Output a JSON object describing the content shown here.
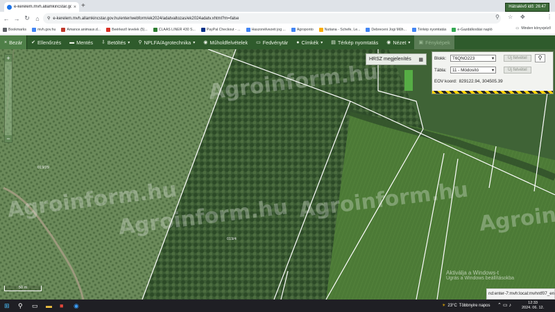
{
  "browser": {
    "tab_title": "e-kerelem.mvh.allamkincstar.go",
    "tab_close": "×",
    "new_tab": "+",
    "url": "e-kerelem.mvh.allamkincstar.gov.hu/enter/webform/ek2024/adatvaltozas/ek2024adatv.xhtml?m=false",
    "profile_initial": "K",
    "bookmarks": [
      {
        "label": "Bookmarks",
        "color": "#5f6368"
      },
      {
        "label": "mvh.gov.hu",
        "color": "#4285f4"
      },
      {
        "label": "Amance.animaux.d...",
        "color": "#c0392b"
      },
      {
        "label": "Beérkező levelek (5)...",
        "color": "#d93025"
      },
      {
        "label": "CLAAS LINER 430 S...",
        "color": "#2e7d32"
      },
      {
        "label": "PayPal Checkout - ...",
        "color": "#003087"
      },
      {
        "label": "Haszonélvezeti jog ...",
        "color": "#4285f4"
      },
      {
        "label": "Agroponto",
        "color": "#4285f4"
      },
      {
        "label": "Nutiana - Schefe, Le...",
        "color": "#f9ab00"
      },
      {
        "label": "Debreceni Jogi Műh...",
        "color": "#4285f4"
      },
      {
        "label": "Térkép nyomtatás",
        "color": "#4285f4"
      },
      {
        "label": "e-Gazdálkodási napló",
        "color": "#34a853"
      }
    ],
    "bookmarks_right": "Minden könyvjelző"
  },
  "toolbar": {
    "items": [
      {
        "label": "Bezár",
        "icon": "×",
        "disabled": false
      },
      {
        "label": "Ellenőrzés",
        "icon": "✔",
        "disabled": false
      },
      {
        "label": "Mentés",
        "icon": "▬",
        "disabled": false
      },
      {
        "label": "Betöltés",
        "icon": "⇩",
        "caret": "▾",
        "disabled": false
      },
      {
        "label": "NPLFA/Agrotechnika",
        "icon": "⚲",
        "caret": "▾",
        "disabled": false
      },
      {
        "label": "Műholdfelvételek",
        "icon": "◉",
        "disabled": false
      },
      {
        "label": "Fedvénytár",
        "icon": "▭",
        "disabled": false
      },
      {
        "label": "Címkék",
        "icon": "●",
        "caret": "▾",
        "disabled": false
      },
      {
        "label": "Térkép nyomtatás",
        "icon": "▤",
        "disabled": false
      },
      {
        "label": "Nézet",
        "icon": "◉",
        "caret": "▾",
        "disabled": false
      },
      {
        "label": "Fényképek",
        "icon": "▣",
        "disabled": true
      }
    ],
    "timer": "Hátralévő idő: 26:47"
  },
  "map": {
    "zoom_in": "+",
    "zoom_out": "−",
    "hrsz_label": "HRSZ megjelenítés",
    "panel": {
      "blokk_label": "Blokk:",
      "blokk_value": "T6QNO223",
      "blokk_btn": "Új felvétel",
      "tabla_label": "Tábla:",
      "tabla_value": "11 - Módosító",
      "tabla_btn": "Új felvétel",
      "eov_label": "EOV koord:",
      "eov_value": "829122.94, 304505.39",
      "caret": "▾"
    },
    "parcel_labels": [
      "019/29",
      "019/4"
    ],
    "scale_label": "50 m",
    "watermarks": [
      "Agroinform.hu",
      "Agroinform.hu",
      "Agroinform.hu",
      "Agroinform.hu",
      "Agroinform.hu"
    ],
    "windows_activation": [
      "Aktiválja a Windows-t",
      "Ugrás a Windows beállításokba"
    ],
    "status_url": "nd:enter-7:mvh:local:mvhntf07_enter04"
  },
  "taskbar": {
    "temperature": "23°C",
    "weather": "Többnyire napos",
    "time": "12:33",
    "date": "2024. 06. 12."
  }
}
